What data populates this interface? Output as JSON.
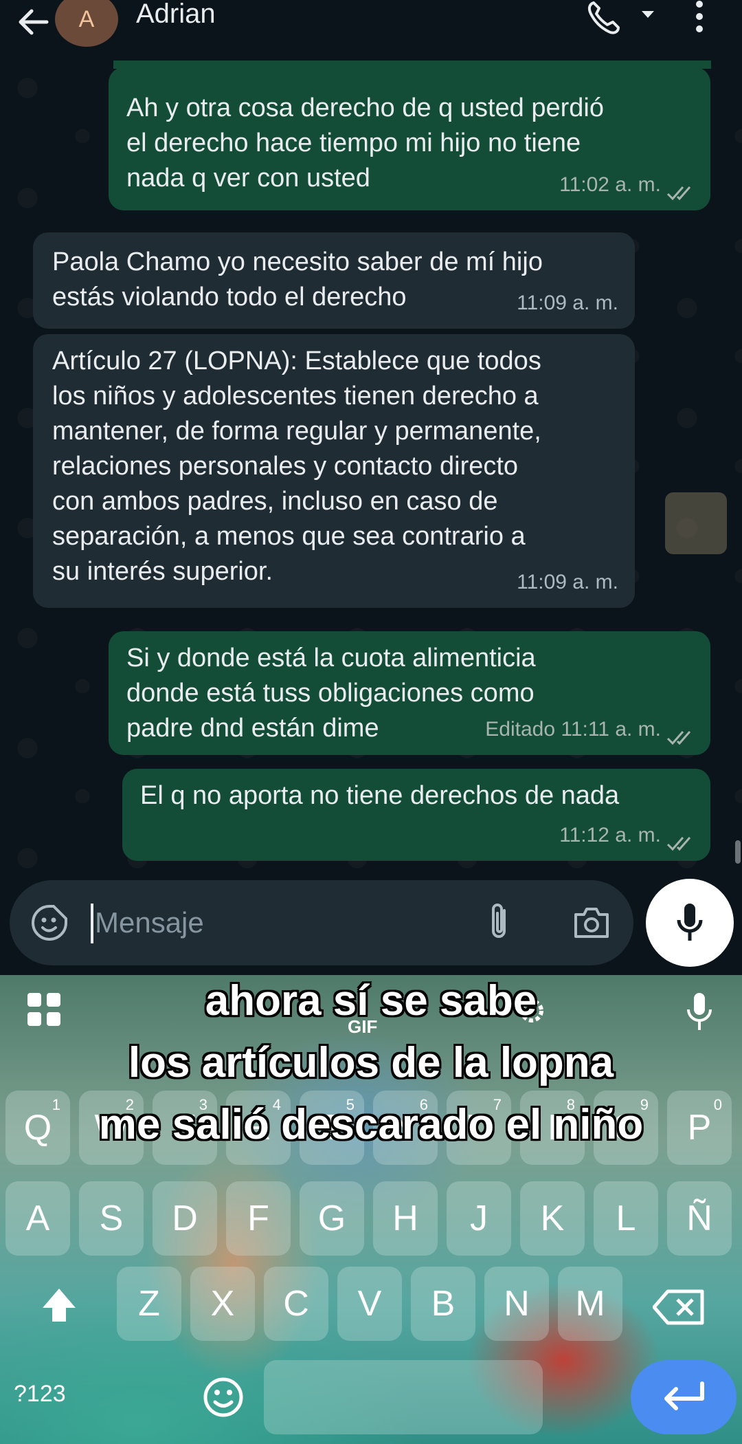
{
  "header": {
    "avatar_letter": "A",
    "contact_name": "Adrian"
  },
  "messages": [
    {
      "direction": "out",
      "lines": [
        "Ah y otra cosa derecho de q usted perdió",
        "el derecho hace tiempo mi hijo no tiene",
        "nada q ver con usted"
      ],
      "time": "11:02 a. m."
    },
    {
      "direction": "in",
      "lines": [
        "Paola Chamo yo necesito saber de mí hijo",
        "estás violando todo el derecho"
      ],
      "time": "11:09 a. m."
    },
    {
      "direction": "in",
      "lines": [
        "Artículo 27 (LOPNA): Establece que todos",
        "los niños y adolescentes tienen derecho a",
        "mantener, de forma regular y permanente,",
        "relaciones personales y contacto directo",
        "con ambos padres, incluso en caso de",
        "separación, a menos que sea contrario a",
        "su interés superior."
      ],
      "time": "11:09 a. m."
    },
    {
      "direction": "out",
      "lines": [
        "Si y donde está la cuota alimenticia",
        "donde está tuss obligaciones como",
        "padre dnd están dime"
      ],
      "time": "Editado 11:11 a. m."
    },
    {
      "direction": "out",
      "lines": [
        "El q no aporta no tiene derechos de nada"
      ],
      "time": "11:12 a. m."
    }
  ],
  "composer": {
    "placeholder": "Mensaje"
  },
  "keyboard": {
    "row1": [
      {
        "key": "Q",
        "hint": "1"
      },
      {
        "key": "W",
        "hint": "2"
      },
      {
        "key": "E",
        "hint": "3"
      },
      {
        "key": "R",
        "hint": "4"
      },
      {
        "key": "T",
        "hint": "5"
      },
      {
        "key": "Y",
        "hint": "6"
      },
      {
        "key": "U",
        "hint": "7"
      },
      {
        "key": "I",
        "hint": "8"
      },
      {
        "key": "O",
        "hint": "9"
      },
      {
        "key": "P",
        "hint": "0"
      }
    ],
    "row2": [
      "A",
      "S",
      "D",
      "F",
      "G",
      "H",
      "J",
      "K",
      "L",
      "Ñ"
    ],
    "row3": [
      "Z",
      "X",
      "C",
      "V",
      "B",
      "N",
      "M"
    ],
    "symbols_label": "?123",
    "gif_label": "GIF"
  },
  "caption": {
    "lines": [
      "ahora sí se sabe",
      "los artículos de la lopna",
      "me salió descarado el niño"
    ]
  },
  "colors": {
    "outgoing_bubble": "#144d37",
    "incoming_bubble": "#202c33",
    "background": "#0b141a",
    "enter_key": "#4b8cf0"
  }
}
